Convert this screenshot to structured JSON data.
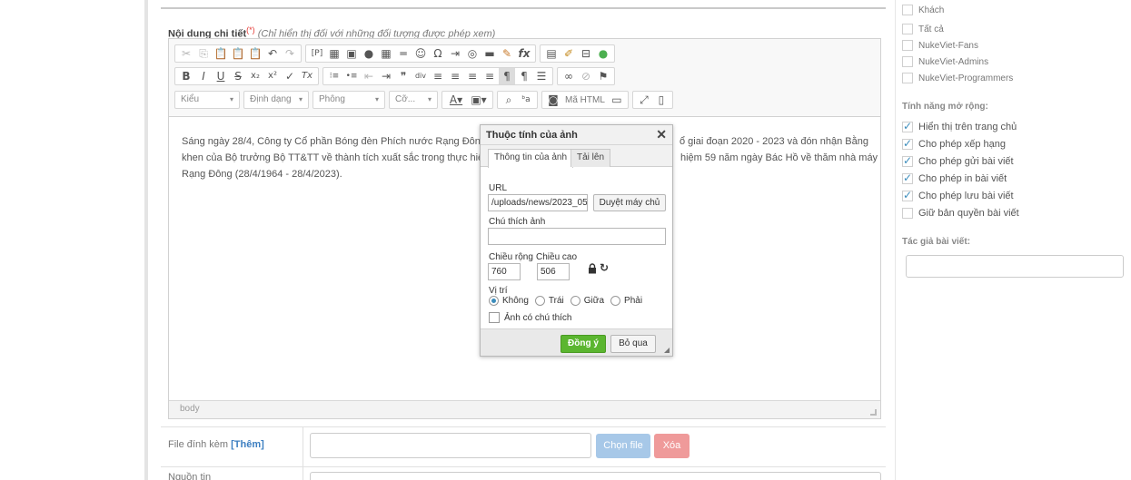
{
  "editor_field": {
    "label": "Nội dung chi tiết",
    "required_mark": "(*)",
    "hint": "(Chỉ hiển thị đối với những đối tượng được phép xem)"
  },
  "toolbar": {
    "combos": {
      "style": "Kiểu",
      "format": "Định dạng",
      "font": "Phông",
      "size": "Cỡ..."
    },
    "source_label": "Mã HTML",
    "row1_icons": [
      "cut-icon",
      "copy-icon",
      "paste-icon",
      "paste-text-icon",
      "paste-word-icon",
      "undo-icon",
      "redo-icon",
      "template-icon",
      "form-icon",
      "image-icon",
      "flash-icon",
      "table-icon",
      "horizontal-rule-icon",
      "smiley-icon",
      "special-char-icon",
      "iframe-icon",
      "youtube-icon",
      "video-icon",
      "code-icon",
      "math-icon",
      "gallery-icon",
      "brush-icon",
      "placeholder-icon",
      "spellcheck-icon"
    ],
    "row1_glyphs": [
      "✂",
      "⎘",
      "📋",
      "📋",
      "📋",
      "↶",
      "↷",
      "[P]",
      "▦",
      "▣",
      "●",
      "▦",
      "═",
      "☺",
      "Ω",
      "⇥",
      "◎",
      "▬",
      "✎",
      "fx",
      "▤",
      "✐",
      "⊟",
      "●"
    ],
    "row2_glyphs": [
      "B",
      "I",
      "U",
      "S",
      "x₂",
      "x²",
      "✓",
      "Tx",
      "⁝≡",
      "•≡",
      "⇤",
      "⇥",
      "❞",
      "div",
      "≡",
      "≡",
      "≡",
      "≡",
      "¶",
      "¶",
      "☰",
      "∞",
      "⊘",
      "⚑"
    ],
    "row2_icons": [
      "bold-icon",
      "italic-icon",
      "underline-icon",
      "strike-icon",
      "subscript-icon",
      "superscript-icon",
      "copy-format-icon",
      "remove-format-icon",
      "numbered-list-icon",
      "bullet-list-icon",
      "outdent-icon",
      "indent-icon",
      "blockquote-icon",
      "div-icon",
      "align-left-icon",
      "align-center-icon",
      "align-right-icon",
      "justify-icon",
      "ltr-icon",
      "rtl-icon",
      "language-icon",
      "link-icon",
      "unlink-icon",
      "anchor-icon"
    ]
  },
  "editor_content": {
    "line1_a": "Sáng ngày 28/4, Công ty Cổ phần Bóng đèn Phích nước Rạng Đông  đã",
    "line1_b": "ổ giai đoạn 2020 - 2023 và đón nhận Bằng",
    "line2_a": "khen của Bộ trưởng Bộ TT&TT về thành tích xuất sắc trong thực hiện ch",
    "line2_b": "hiệm 59 năm ngày Bác Hồ về thăm nhà máy",
    "line3": "Rạng Đông (28/4/1964 - 28/4/2023).",
    "status_path": "body"
  },
  "image_dialog": {
    "title": "Thuộc tính của ảnh",
    "close_glyph": "✕",
    "tabs": [
      "Thông tin của ảnh",
      "Tải lên"
    ],
    "url_label": "URL",
    "url_value": "/uploads/news/2023_05",
    "browse_button": "Duyệt máy chủ",
    "caption_label": "Chú thích ảnh",
    "caption_value": "",
    "width_label": "Chiều rộng",
    "width_value": "760",
    "height_label": "Chiều cao",
    "height_value": "506",
    "refresh_glyph": "↻",
    "align_label": "Vị trí",
    "align_options": [
      "Không",
      "Trái",
      "Giữa",
      "Phải"
    ],
    "align_selected": "Không",
    "has_caption_label": "Ảnh có chú thích",
    "ok_button": "Đồng ý",
    "cancel_button": "Bỏ qua"
  },
  "attachments": {
    "label": "File đính kèm",
    "add_link": "[Thêm]",
    "choose_button": "Chọn file",
    "delete_button": "Xóa"
  },
  "source_field": {
    "label": "Nguồn tin"
  },
  "sidebar": {
    "groups": [
      {
        "label": "Khách",
        "checked": false
      },
      {
        "label": "Tất cả",
        "checked": false
      },
      {
        "label": "NukeViet-Fans",
        "checked": false
      },
      {
        "label": "NukeViet-Admins",
        "checked": false
      },
      {
        "label": "NukeViet-Programmers",
        "checked": false
      }
    ],
    "features_title": "Tính năng mở rộng:",
    "features": [
      {
        "label": "Hiển thị trên trang chủ",
        "checked": true
      },
      {
        "label": "Cho phép xếp hạng",
        "checked": true
      },
      {
        "label": "Cho phép gửi bài viết",
        "checked": true
      },
      {
        "label": "Cho phép in bài viết",
        "checked": true
      },
      {
        "label": "Cho phép lưu bài viết",
        "checked": true
      },
      {
        "label": "Giữ bản quyền bài viết",
        "checked": false
      }
    ],
    "author_title": "Tác giả bài viết:",
    "author_value": ""
  },
  "colors": {
    "ok_green": "#5bb630",
    "choose_blue": "#a7c8e8",
    "delete_red": "#ef9a9a",
    "check_blue": "#3c8dbc",
    "link_blue": "#3d7fc1"
  }
}
